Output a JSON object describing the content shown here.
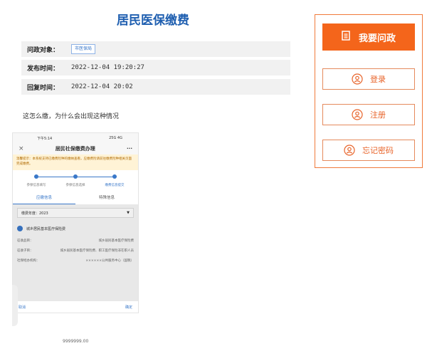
{
  "article": {
    "title": "居民医保缴费",
    "rows": [
      {
        "label": "问政对象：",
        "value": "",
        "tag": "市医保局"
      },
      {
        "label": "发布时间：",
        "value": "2022-12-04 19:20:27"
      },
      {
        "label": "回复时间：",
        "value": "2022-12-04 20:02"
      }
    ],
    "question": "这怎么缴，为什么会出现这种情况"
  },
  "phone": {
    "status_time": "下午5:14",
    "status_right": "25G 4G",
    "nav_title": "居民社保缴费办理",
    "close": "×",
    "more": "···",
    "notice": "温馨提示：本系统支持已缴费险种的缴纳查看，应缴费险请前往缴费险种相关页面完成缴费。",
    "steps": [
      "参保信息填写",
      "参保信息选择",
      "缴费信息提交"
    ],
    "tabs": [
      "应缴信息",
      "特殊信息"
    ],
    "select_label": "缴费年度：2023",
    "select_arrow": "▼",
    "insurance_name": "城乡居民基本医疗保险费",
    "kv": [
      {
        "k": "征收品目：",
        "v": "城乡居民基本医疗保险费"
      },
      {
        "k": "征收子目：",
        "v": "城乡居民基本医疗保险费、职工医疗保险非在职人员"
      },
      {
        "k": "社保经办机构：",
        "v": "××××××公共服务中心（国税）"
      }
    ],
    "cancel": "取消",
    "confirm": "确定"
  },
  "amount_text": "9999999.00",
  "panel": {
    "primary": "我要问政",
    "login": "登录",
    "register": "注册",
    "forgot": "忘记密码"
  },
  "colors": {
    "accent": "#f4651b",
    "title_blue": "#1f5fb0",
    "phone_blue": "#3a78c9"
  }
}
